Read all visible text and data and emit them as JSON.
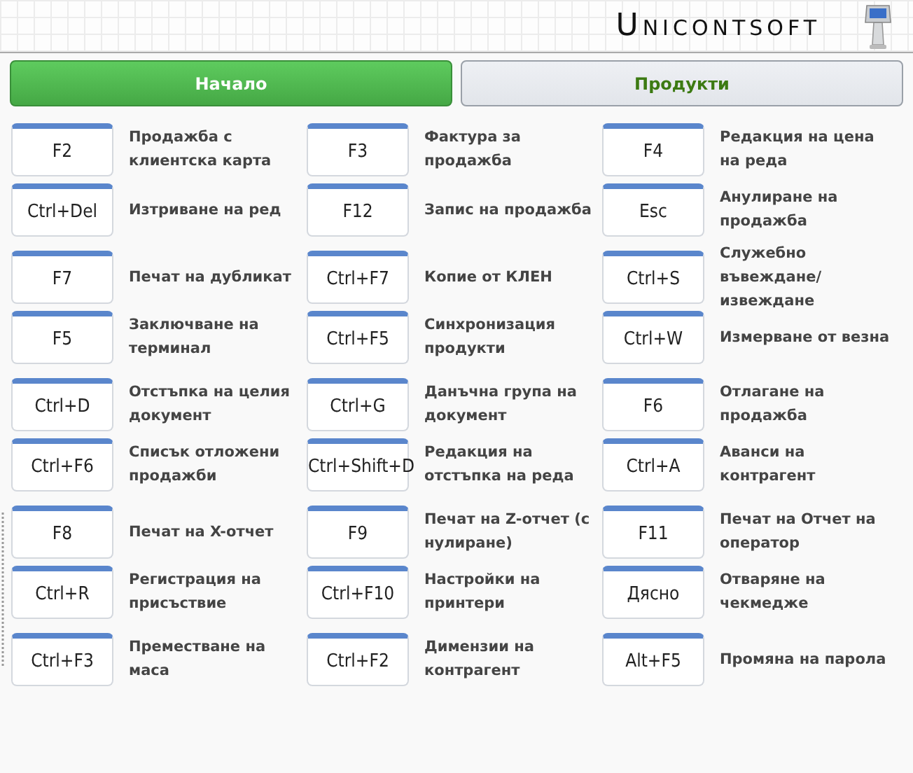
{
  "header": {
    "logo": "Unicontsoft"
  },
  "tabs": [
    {
      "label": "Начало",
      "selected": true
    },
    {
      "label": "Продукти",
      "selected": false
    }
  ],
  "groups": [
    {
      "shortcuts": [
        {
          "key": "F2",
          "action": "Продажба с клиентска карта"
        },
        {
          "key": "F3",
          "action": "Фактура за продажба"
        },
        {
          "key": "F4",
          "action": "Редакция на цена на реда"
        },
        {
          "key": "Ctrl+Del",
          "action": "Изтриване на ред"
        },
        {
          "key": "F12",
          "action": "Запис на продажба"
        },
        {
          "key": "Esc",
          "action": "Анулиране на продажба"
        }
      ]
    },
    {
      "shortcuts": [
        {
          "key": "F7",
          "action": "Печат на дубликат"
        },
        {
          "key": "Ctrl+F7",
          "action": "Копие от КЛЕН"
        },
        {
          "key": "Ctrl+S",
          "action": "Служебно въвеждане/извеждане"
        },
        {
          "key": "F5",
          "action": "Заключване на терминал"
        },
        {
          "key": "Ctrl+F5",
          "action": "Синхронизация продукти"
        },
        {
          "key": "Ctrl+W",
          "action": "Измерване от везна"
        }
      ]
    },
    {
      "shortcuts": [
        {
          "key": "Ctrl+D",
          "action": "Отстъпка на целия документ"
        },
        {
          "key": "Ctrl+G",
          "action": "Данъчна група на документ"
        },
        {
          "key": "F6",
          "action": "Отлагане на продажба"
        },
        {
          "key": "Ctrl+F6",
          "action": "Списък отложени продажби"
        },
        {
          "key": "Ctrl+Shift+D",
          "action": "Редакция на отстъпка на реда"
        },
        {
          "key": "Ctrl+A",
          "action": "Аванси на контрагент"
        }
      ]
    },
    {
      "shortcuts": [
        {
          "key": "F8",
          "action": "Печат на X-отчет"
        },
        {
          "key": "F9",
          "action": "Печат на Z-отчет (с нулиране)"
        },
        {
          "key": "F11",
          "action": "Печат на Отчет на оператор"
        },
        {
          "key": "Ctrl+R",
          "action": "Регистрация на присъствие"
        },
        {
          "key": "Ctrl+F10",
          "action": "Настройки на принтери"
        },
        {
          "key": "Дясно",
          "action": "Отваряне на чекмедже"
        }
      ]
    },
    {
      "shortcuts": [
        {
          "key": "Ctrl+F3",
          "action": "Преместване на маса"
        },
        {
          "key": "Ctrl+F2",
          "action": "Димензии на контрагент"
        },
        {
          "key": "Alt+F5",
          "action": "Промяна на парола"
        }
      ]
    }
  ]
}
